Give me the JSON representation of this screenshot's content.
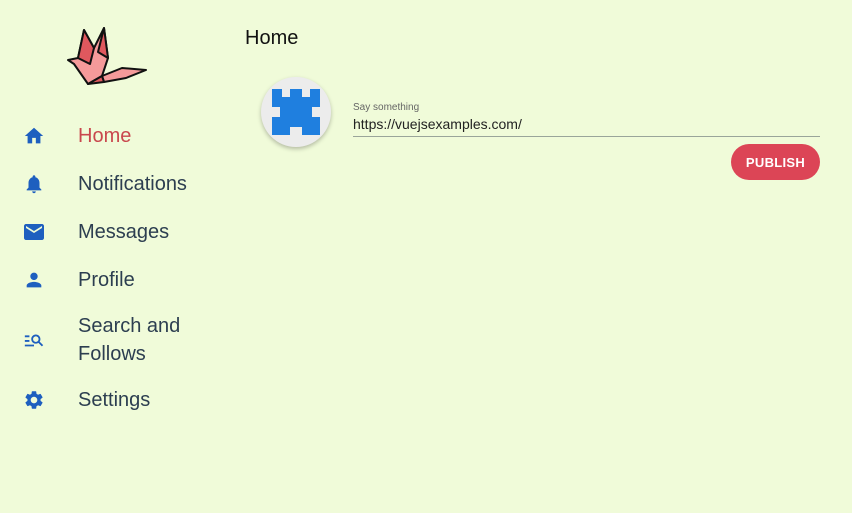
{
  "app": {
    "logo": "origami-crane-logo"
  },
  "sidebar": {
    "items": [
      {
        "label": "Home",
        "icon": "home-icon",
        "active": true
      },
      {
        "label": "Notifications",
        "icon": "bell-icon",
        "active": false
      },
      {
        "label": "Messages",
        "icon": "mail-icon",
        "active": false
      },
      {
        "label": "Profile",
        "icon": "person-icon",
        "active": false
      },
      {
        "label": "Search and Follows",
        "icon": "search-list-icon",
        "active": false
      },
      {
        "label": "Settings",
        "icon": "gear-icon",
        "active": false
      }
    ]
  },
  "main": {
    "title": "Home",
    "composer": {
      "label": "Say something",
      "value": "https://vuejsexamples.com/",
      "publish_label": "PUBLISH"
    }
  },
  "colors": {
    "background": "#f0fbd9",
    "accent": "#dc4556",
    "active_nav": "#c9474d",
    "icon": "#1e5fbf"
  }
}
